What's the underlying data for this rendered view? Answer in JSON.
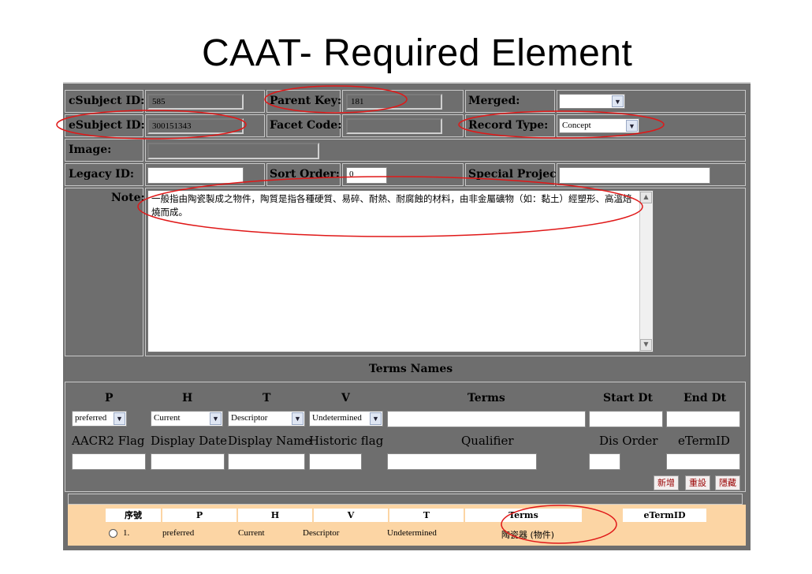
{
  "slide_title": "CAAT- Required Element",
  "fields": {
    "csubject_label": "cSubject ID:",
    "csubject_value": "585",
    "parent_key_label": "Parent Key:",
    "parent_key_value": "181",
    "merged_label": "Merged:",
    "merged_value": "",
    "esubject_label": "eSubject ID:",
    "esubject_value": "300151343",
    "facet_code_label": "Facet Code:",
    "facet_code_value": "",
    "record_type_label": "Record Type:",
    "record_type_value": "Concept",
    "image_label": "Image:",
    "image_value": "",
    "legacy_label": "Legacy ID:",
    "legacy_value": "",
    "sort_order_label": "Sort Order:",
    "sort_order_value": "0",
    "special_project_label": "Special Project:",
    "special_project_value": "",
    "note_label": "Note:",
    "note_value": "一般指由陶瓷製成之物件，陶質是指各種硬質、易碎、耐熱、耐腐蝕的材料，由非金屬礦物（如：黏土）經塑形、高溫焙燒而成。"
  },
  "terms_section": {
    "title": "Terms Names",
    "headers": [
      "P",
      "H",
      "T",
      "V",
      "Terms",
      "Start Dt",
      "End Dt"
    ],
    "selects": [
      "preferred",
      "Current",
      "Descriptor",
      "Undetermined"
    ],
    "headers2": [
      "AACR2 Flag",
      "Display Date",
      "Display Name",
      "Historic flag",
      "Qualifier",
      "Dis Order",
      "eTermID"
    ],
    "buttons": [
      "新增",
      "重設",
      "隱藏"
    ]
  },
  "results": {
    "headers": [
      "序號",
      "P",
      "H",
      "V",
      "T",
      "Terms",
      "eTermID"
    ],
    "row": {
      "index": "1.",
      "p": "preferred",
      "h": "Current",
      "v": "Descriptor",
      "t": "Undetermined",
      "terms": "陶瓷器 (物件)"
    }
  },
  "colors": {
    "panel_gray": "#6e6e6e",
    "result_bg": "#fcd5a4",
    "annotation_red": "#e01818"
  },
  "icons": {
    "dropdown": "chevron-down-icon",
    "radio": "radio-button"
  }
}
